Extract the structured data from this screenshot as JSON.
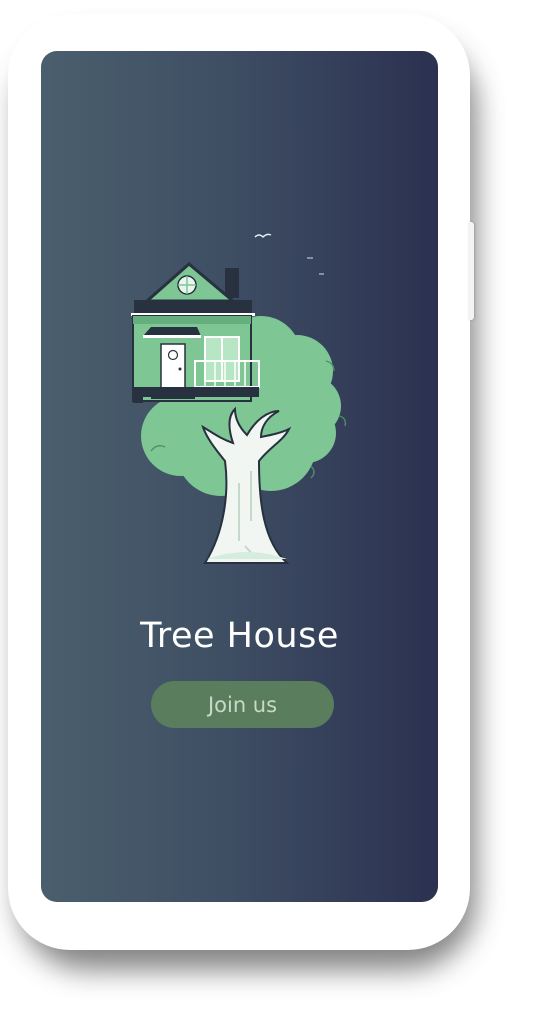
{
  "app": {
    "title": "Tree House",
    "join_label": "Join us"
  },
  "illustration": {
    "subject": "tree-house-icon"
  },
  "colors": {
    "screen_gradient_start": "#4a5f6d",
    "screen_gradient_end": "#2b3150",
    "tree_foliage": "#7ec694",
    "button_bg": "#5a7d5d",
    "button_text": "#c9d9c7"
  }
}
